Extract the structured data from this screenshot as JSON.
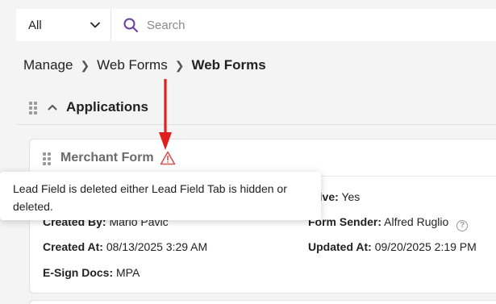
{
  "search": {
    "scope_value": "All",
    "placeholder": "Search",
    "value": ""
  },
  "breadcrumb": {
    "items": [
      "Manage",
      "Web Forms"
    ],
    "current": "Web Forms"
  },
  "section": {
    "title": "Applications"
  },
  "form_card": {
    "title": "Merchant Form",
    "fields": {
      "active_label": "tive:",
      "active_value": "Yes",
      "created_by_label": "Created By:",
      "created_by_value": "Mario Pavic",
      "form_sender_label": "Form Sender:",
      "form_sender_value": "Alfred Ruglio",
      "created_at_label": "Created At:",
      "created_at_value": "08/13/2025 3:29 AM",
      "updated_at_label": "Updated At:",
      "updated_at_value": "09/20/2025 2:19 PM",
      "esign_label": "E-Sign Docs:",
      "esign_value": "MPA"
    }
  },
  "tooltip": {
    "text": "Lead Field is deleted either Lead Field Tab is hidden or deleted."
  },
  "colors": {
    "annotation_arrow": "#e0201c",
    "warning_icon": "#d9534f",
    "search_icon": "#6b3fa0"
  }
}
